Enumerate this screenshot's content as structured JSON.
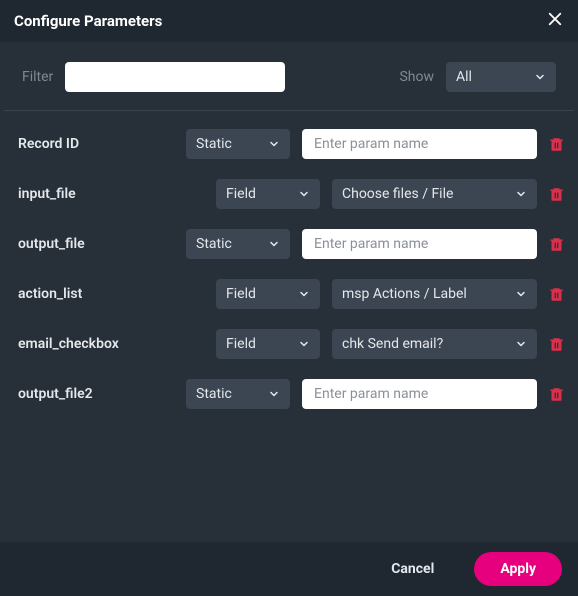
{
  "title": "Configure Parameters",
  "filter": {
    "label": "Filter",
    "value": ""
  },
  "show": {
    "label": "Show",
    "selected": "All"
  },
  "paramPlaceholder": "Enter param name",
  "rows": [
    {
      "label": "Record ID",
      "type": "Static",
      "value": ""
    },
    {
      "label": "input_file",
      "type": "Field",
      "value": "Choose files / File"
    },
    {
      "label": "output_file",
      "type": "Static",
      "value": ""
    },
    {
      "label": "action_list",
      "type": "Field",
      "value": "msp Actions / Label"
    },
    {
      "label": "email_checkbox",
      "type": "Field",
      "value": "chk Send email?"
    },
    {
      "label": "output_file2",
      "type": "Static",
      "value": ""
    }
  ],
  "footer": {
    "cancel": "Cancel",
    "apply": "Apply"
  }
}
